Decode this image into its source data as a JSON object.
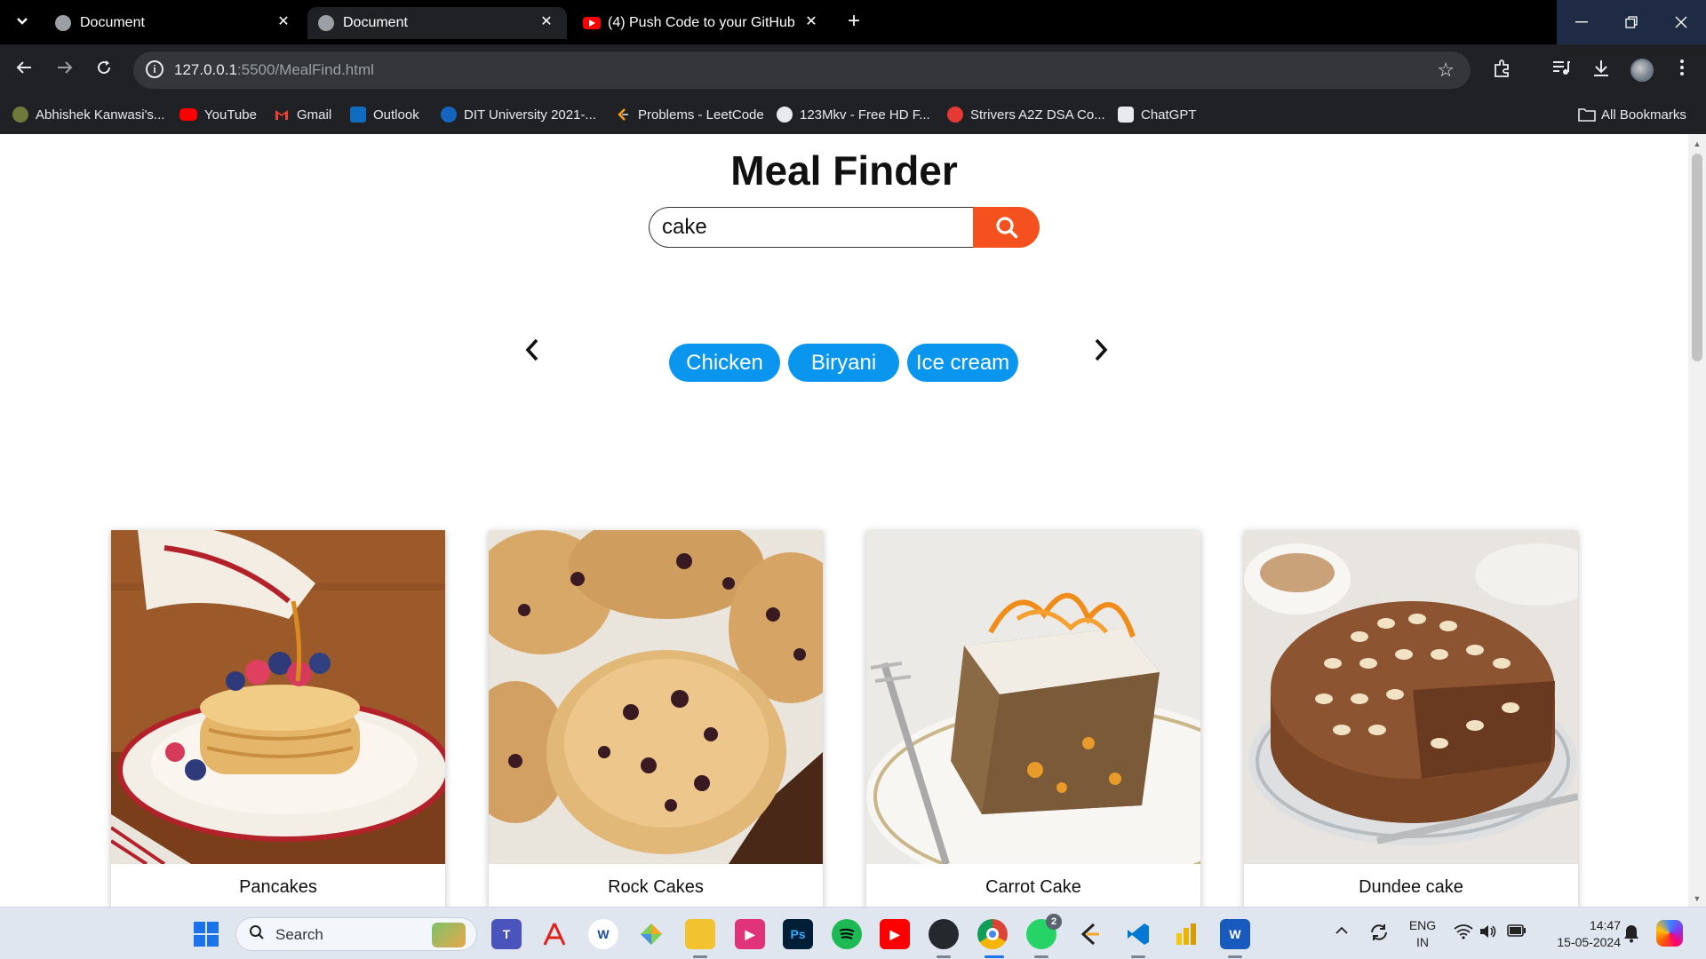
{
  "browser": {
    "tabs": [
      {
        "title": "Document",
        "active": false
      },
      {
        "title": "Document",
        "active": true
      },
      {
        "title": "(4) Push Code to your GitHub A",
        "active": false
      }
    ],
    "url_host": "127.0.0.1",
    "url_rest": ":5500/MealFind.html",
    "bookmarks": [
      {
        "label": "Abhishek Kanwasi's...",
        "icon": "github-icon",
        "color": "#e8eaed"
      },
      {
        "label": "YouTube",
        "icon": "youtube-icon",
        "color": "#ff0000"
      },
      {
        "label": "Gmail",
        "icon": "gmail-icon",
        "color": "#ea4335"
      },
      {
        "label": "Outlook",
        "icon": "outlook-icon",
        "color": "#0f6cbd"
      },
      {
        "label": "DIT University 2021-...",
        "icon": "dit-icon",
        "color": "#1565c0"
      },
      {
        "label": "Problems - LeetCode",
        "icon": "leetcode-icon",
        "color": "#ffa116"
      },
      {
        "label": "123Mkv - Free HD F...",
        "icon": "wordpress-icon",
        "color": "#e8eaed"
      },
      {
        "label": "Strivers A2Z DSA Co...",
        "icon": "tuf-icon",
        "color": "#e53935"
      },
      {
        "label": "ChatGPT",
        "icon": "chatgpt-icon",
        "color": "#e8eaed"
      }
    ],
    "all_bookmarks": "All Bookmarks"
  },
  "page": {
    "title": "Meal Finder",
    "search_value": "cake",
    "search_button_color": "#f4511e",
    "chips": [
      "Chicken",
      "Biryani",
      "Ice cream"
    ],
    "chip_color": "#0a95ee",
    "meals": [
      {
        "name": "Pancakes"
      },
      {
        "name": "Rock Cakes"
      },
      {
        "name": "Carrot Cake"
      },
      {
        "name": "Dundee cake"
      }
    ]
  },
  "taskbar": {
    "search_label": "Search",
    "lang_line1": "ENG",
    "lang_line2": "IN",
    "time": "14:47",
    "date": "15-05-2024",
    "whatsapp_badge": "2"
  }
}
